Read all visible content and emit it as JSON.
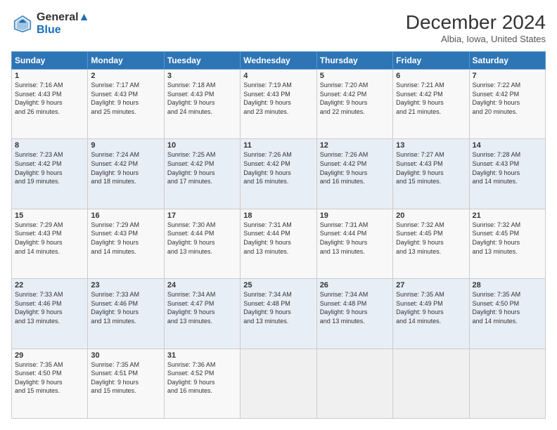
{
  "logo": {
    "line1": "General",
    "line2": "Blue"
  },
  "title": "December 2024",
  "location": "Albia, Iowa, United States",
  "days_of_week": [
    "Sunday",
    "Monday",
    "Tuesday",
    "Wednesday",
    "Thursday",
    "Friday",
    "Saturday"
  ],
  "weeks": [
    [
      {
        "day": "1",
        "info": "Sunrise: 7:16 AM\nSunset: 4:43 PM\nDaylight: 9 hours\nand 26 minutes."
      },
      {
        "day": "2",
        "info": "Sunrise: 7:17 AM\nSunset: 4:43 PM\nDaylight: 9 hours\nand 25 minutes."
      },
      {
        "day": "3",
        "info": "Sunrise: 7:18 AM\nSunset: 4:43 PM\nDaylight: 9 hours\nand 24 minutes."
      },
      {
        "day": "4",
        "info": "Sunrise: 7:19 AM\nSunset: 4:43 PM\nDaylight: 9 hours\nand 23 minutes."
      },
      {
        "day": "5",
        "info": "Sunrise: 7:20 AM\nSunset: 4:42 PM\nDaylight: 9 hours\nand 22 minutes."
      },
      {
        "day": "6",
        "info": "Sunrise: 7:21 AM\nSunset: 4:42 PM\nDaylight: 9 hours\nand 21 minutes."
      },
      {
        "day": "7",
        "info": "Sunrise: 7:22 AM\nSunset: 4:42 PM\nDaylight: 9 hours\nand 20 minutes."
      }
    ],
    [
      {
        "day": "8",
        "info": "Sunrise: 7:23 AM\nSunset: 4:42 PM\nDaylight: 9 hours\nand 19 minutes."
      },
      {
        "day": "9",
        "info": "Sunrise: 7:24 AM\nSunset: 4:42 PM\nDaylight: 9 hours\nand 18 minutes."
      },
      {
        "day": "10",
        "info": "Sunrise: 7:25 AM\nSunset: 4:42 PM\nDaylight: 9 hours\nand 17 minutes."
      },
      {
        "day": "11",
        "info": "Sunrise: 7:26 AM\nSunset: 4:42 PM\nDaylight: 9 hours\nand 16 minutes."
      },
      {
        "day": "12",
        "info": "Sunrise: 7:26 AM\nSunset: 4:42 PM\nDaylight: 9 hours\nand 16 minutes."
      },
      {
        "day": "13",
        "info": "Sunrise: 7:27 AM\nSunset: 4:43 PM\nDaylight: 9 hours\nand 15 minutes."
      },
      {
        "day": "14",
        "info": "Sunrise: 7:28 AM\nSunset: 4:43 PM\nDaylight: 9 hours\nand 14 minutes."
      }
    ],
    [
      {
        "day": "15",
        "info": "Sunrise: 7:29 AM\nSunset: 4:43 PM\nDaylight: 9 hours\nand 14 minutes."
      },
      {
        "day": "16",
        "info": "Sunrise: 7:29 AM\nSunset: 4:43 PM\nDaylight: 9 hours\nand 14 minutes."
      },
      {
        "day": "17",
        "info": "Sunrise: 7:30 AM\nSunset: 4:44 PM\nDaylight: 9 hours\nand 13 minutes."
      },
      {
        "day": "18",
        "info": "Sunrise: 7:31 AM\nSunset: 4:44 PM\nDaylight: 9 hours\nand 13 minutes."
      },
      {
        "day": "19",
        "info": "Sunrise: 7:31 AM\nSunset: 4:44 PM\nDaylight: 9 hours\nand 13 minutes."
      },
      {
        "day": "20",
        "info": "Sunrise: 7:32 AM\nSunset: 4:45 PM\nDaylight: 9 hours\nand 13 minutes."
      },
      {
        "day": "21",
        "info": "Sunrise: 7:32 AM\nSunset: 4:45 PM\nDaylight: 9 hours\nand 13 minutes."
      }
    ],
    [
      {
        "day": "22",
        "info": "Sunrise: 7:33 AM\nSunset: 4:46 PM\nDaylight: 9 hours\nand 13 minutes."
      },
      {
        "day": "23",
        "info": "Sunrise: 7:33 AM\nSunset: 4:46 PM\nDaylight: 9 hours\nand 13 minutes."
      },
      {
        "day": "24",
        "info": "Sunrise: 7:34 AM\nSunset: 4:47 PM\nDaylight: 9 hours\nand 13 minutes."
      },
      {
        "day": "25",
        "info": "Sunrise: 7:34 AM\nSunset: 4:48 PM\nDaylight: 9 hours\nand 13 minutes."
      },
      {
        "day": "26",
        "info": "Sunrise: 7:34 AM\nSunset: 4:48 PM\nDaylight: 9 hours\nand 13 minutes."
      },
      {
        "day": "27",
        "info": "Sunrise: 7:35 AM\nSunset: 4:49 PM\nDaylight: 9 hours\nand 14 minutes."
      },
      {
        "day": "28",
        "info": "Sunrise: 7:35 AM\nSunset: 4:50 PM\nDaylight: 9 hours\nand 14 minutes."
      }
    ],
    [
      {
        "day": "29",
        "info": "Sunrise: 7:35 AM\nSunset: 4:50 PM\nDaylight: 9 hours\nand 15 minutes."
      },
      {
        "day": "30",
        "info": "Sunrise: 7:35 AM\nSunset: 4:51 PM\nDaylight: 9 hours\nand 15 minutes."
      },
      {
        "day": "31",
        "info": "Sunrise: 7:36 AM\nSunset: 4:52 PM\nDaylight: 9 hours\nand 16 minutes."
      },
      {
        "day": "",
        "info": ""
      },
      {
        "day": "",
        "info": ""
      },
      {
        "day": "",
        "info": ""
      },
      {
        "day": "",
        "info": ""
      }
    ]
  ]
}
